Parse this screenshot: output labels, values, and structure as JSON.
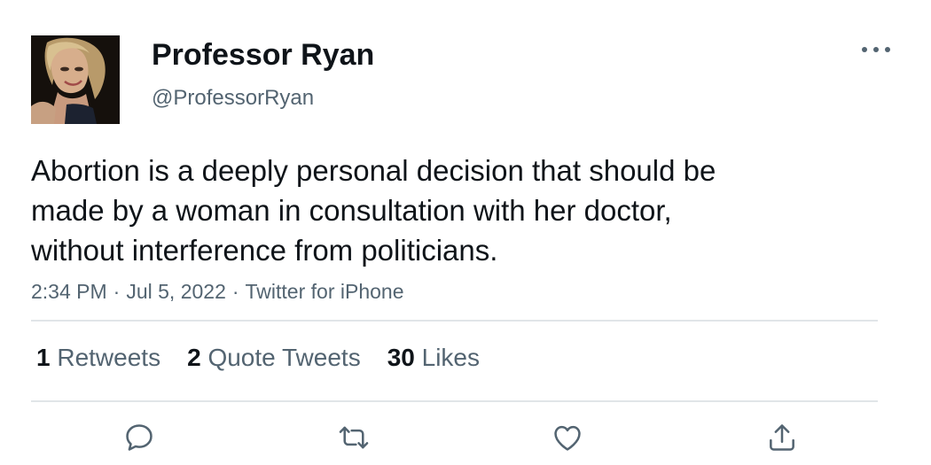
{
  "tweet": {
    "author": {
      "display_name": "Professor Ryan",
      "handle": "@ProfessorRyan"
    },
    "text": "Abortion is a deeply personal decision that should be\nmade by a woman in consultation with her doctor,\nwithout interference from politicians.",
    "time": "2:34 PM",
    "date": "Jul 5, 2022",
    "source": "Twitter for iPhone",
    "separator": "·"
  },
  "stats": {
    "retweets": {
      "count": "1",
      "label": "Retweets"
    },
    "quotes": {
      "count": "2",
      "label": "Quote Tweets"
    },
    "likes": {
      "count": "30",
      "label": "Likes"
    }
  },
  "icons": {
    "more": "more-options-icon",
    "reply": "reply-icon",
    "retweet": "retweet-icon",
    "like": "heart-icon",
    "share": "share-icon"
  },
  "colors": {
    "text": "#0f1419",
    "secondary": "#536471",
    "divider": "#e1e5e8"
  }
}
